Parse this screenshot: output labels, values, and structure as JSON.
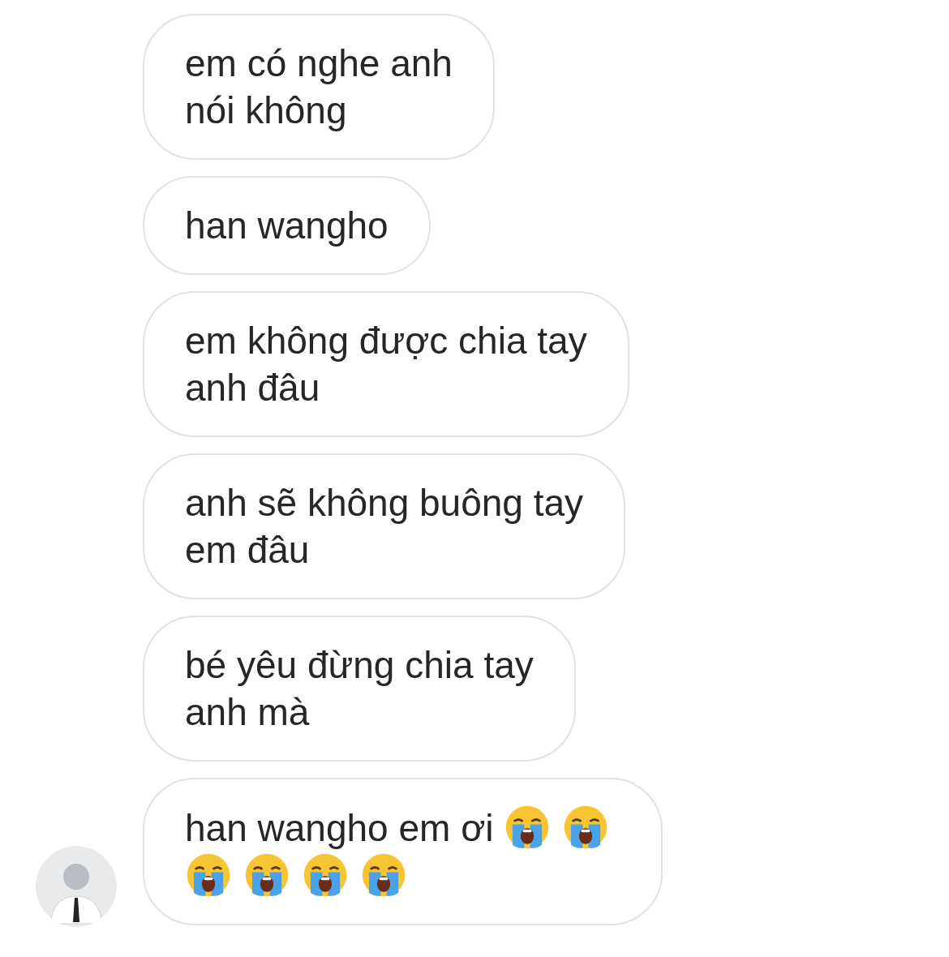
{
  "messages": [
    {
      "parts": [
        {
          "kind": "text",
          "text": "em có nghe anh\nnói không"
        }
      ]
    },
    {
      "parts": [
        {
          "kind": "text",
          "text": "han wangho"
        }
      ]
    },
    {
      "parts": [
        {
          "kind": "text",
          "text": "em không được chia tay\nanh đâu"
        }
      ]
    },
    {
      "parts": [
        {
          "kind": "text",
          "text": "anh sẽ không buông tay\nem đâu"
        }
      ]
    },
    {
      "parts": [
        {
          "kind": "text",
          "text": "bé yêu đừng chia tay\nanh mà"
        }
      ]
    },
    {
      "parts": [
        {
          "kind": "text",
          "text": "han wangho em ơi "
        },
        {
          "kind": "crying-emoji"
        },
        {
          "kind": "crying-emoji"
        },
        {
          "kind": "break"
        },
        {
          "kind": "crying-emoji"
        },
        {
          "kind": "crying-emoji"
        },
        {
          "kind": "crying-emoji"
        },
        {
          "kind": "crying-emoji"
        }
      ],
      "show_avatar": true
    }
  ]
}
